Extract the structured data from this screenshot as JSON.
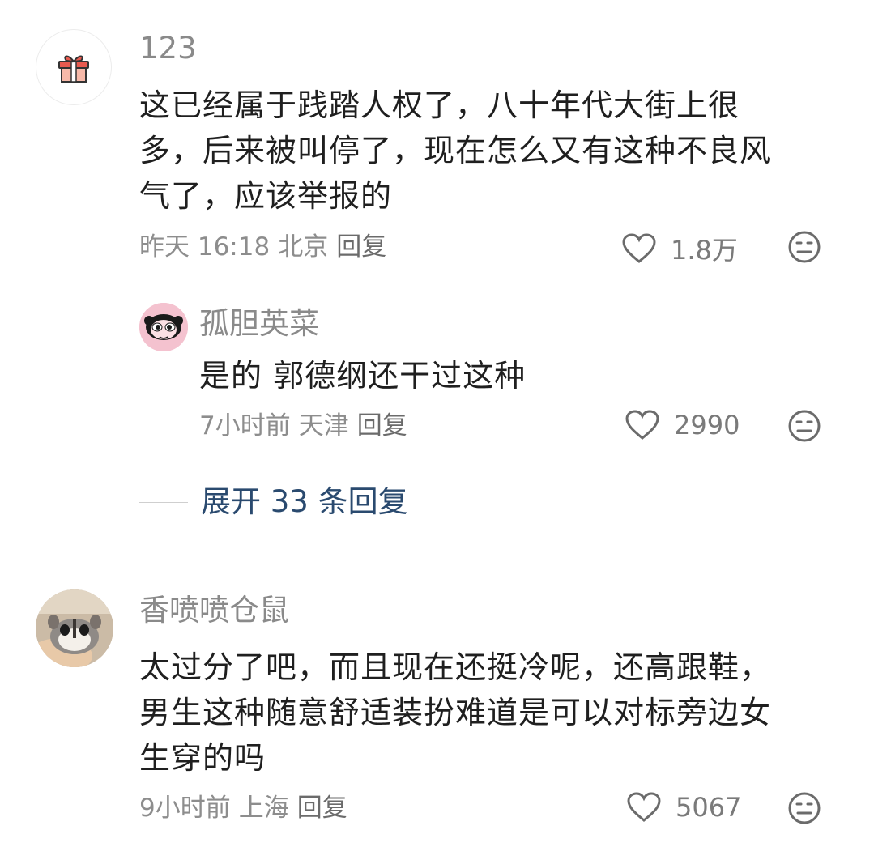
{
  "comments": [
    {
      "username": "123",
      "avatar_icon": "gift-icon",
      "lines": [
        "这已经属于践踏人权了，八十年代大街上很",
        "多，后来被叫停了，现在怎么又有这种不良风",
        "气了，应该举报的"
      ],
      "time": "昨天 16:18",
      "location": "北京",
      "reply_label": "回复",
      "likes": "1.8万"
    },
    {
      "username": "孤胆英菜",
      "avatar_icon": "cartoon-girl-avatar",
      "lines": [
        "是的 郭德纲还干过这种"
      ],
      "time": "7小时前",
      "location": "天津",
      "reply_label": "回复",
      "likes": "2990"
    },
    {
      "username": "香喷喷仓鼠",
      "avatar_icon": "hamster-photo-avatar",
      "lines": [
        "太过分了吧，而且现在还挺冷呢，还高跟鞋，",
        "男生这种随意舒适装扮难道是可以对标旁边女",
        "生穿的吗"
      ],
      "time": "9小时前",
      "location": "上海",
      "reply_label": "回复",
      "likes": "5067"
    }
  ],
  "expand_replies": "展开 33 条回复",
  "colors": {
    "username": "#8a8a8a",
    "meta": "#8d8d8d",
    "expand": "#2a4a6f",
    "text": "#1f1f1f"
  }
}
